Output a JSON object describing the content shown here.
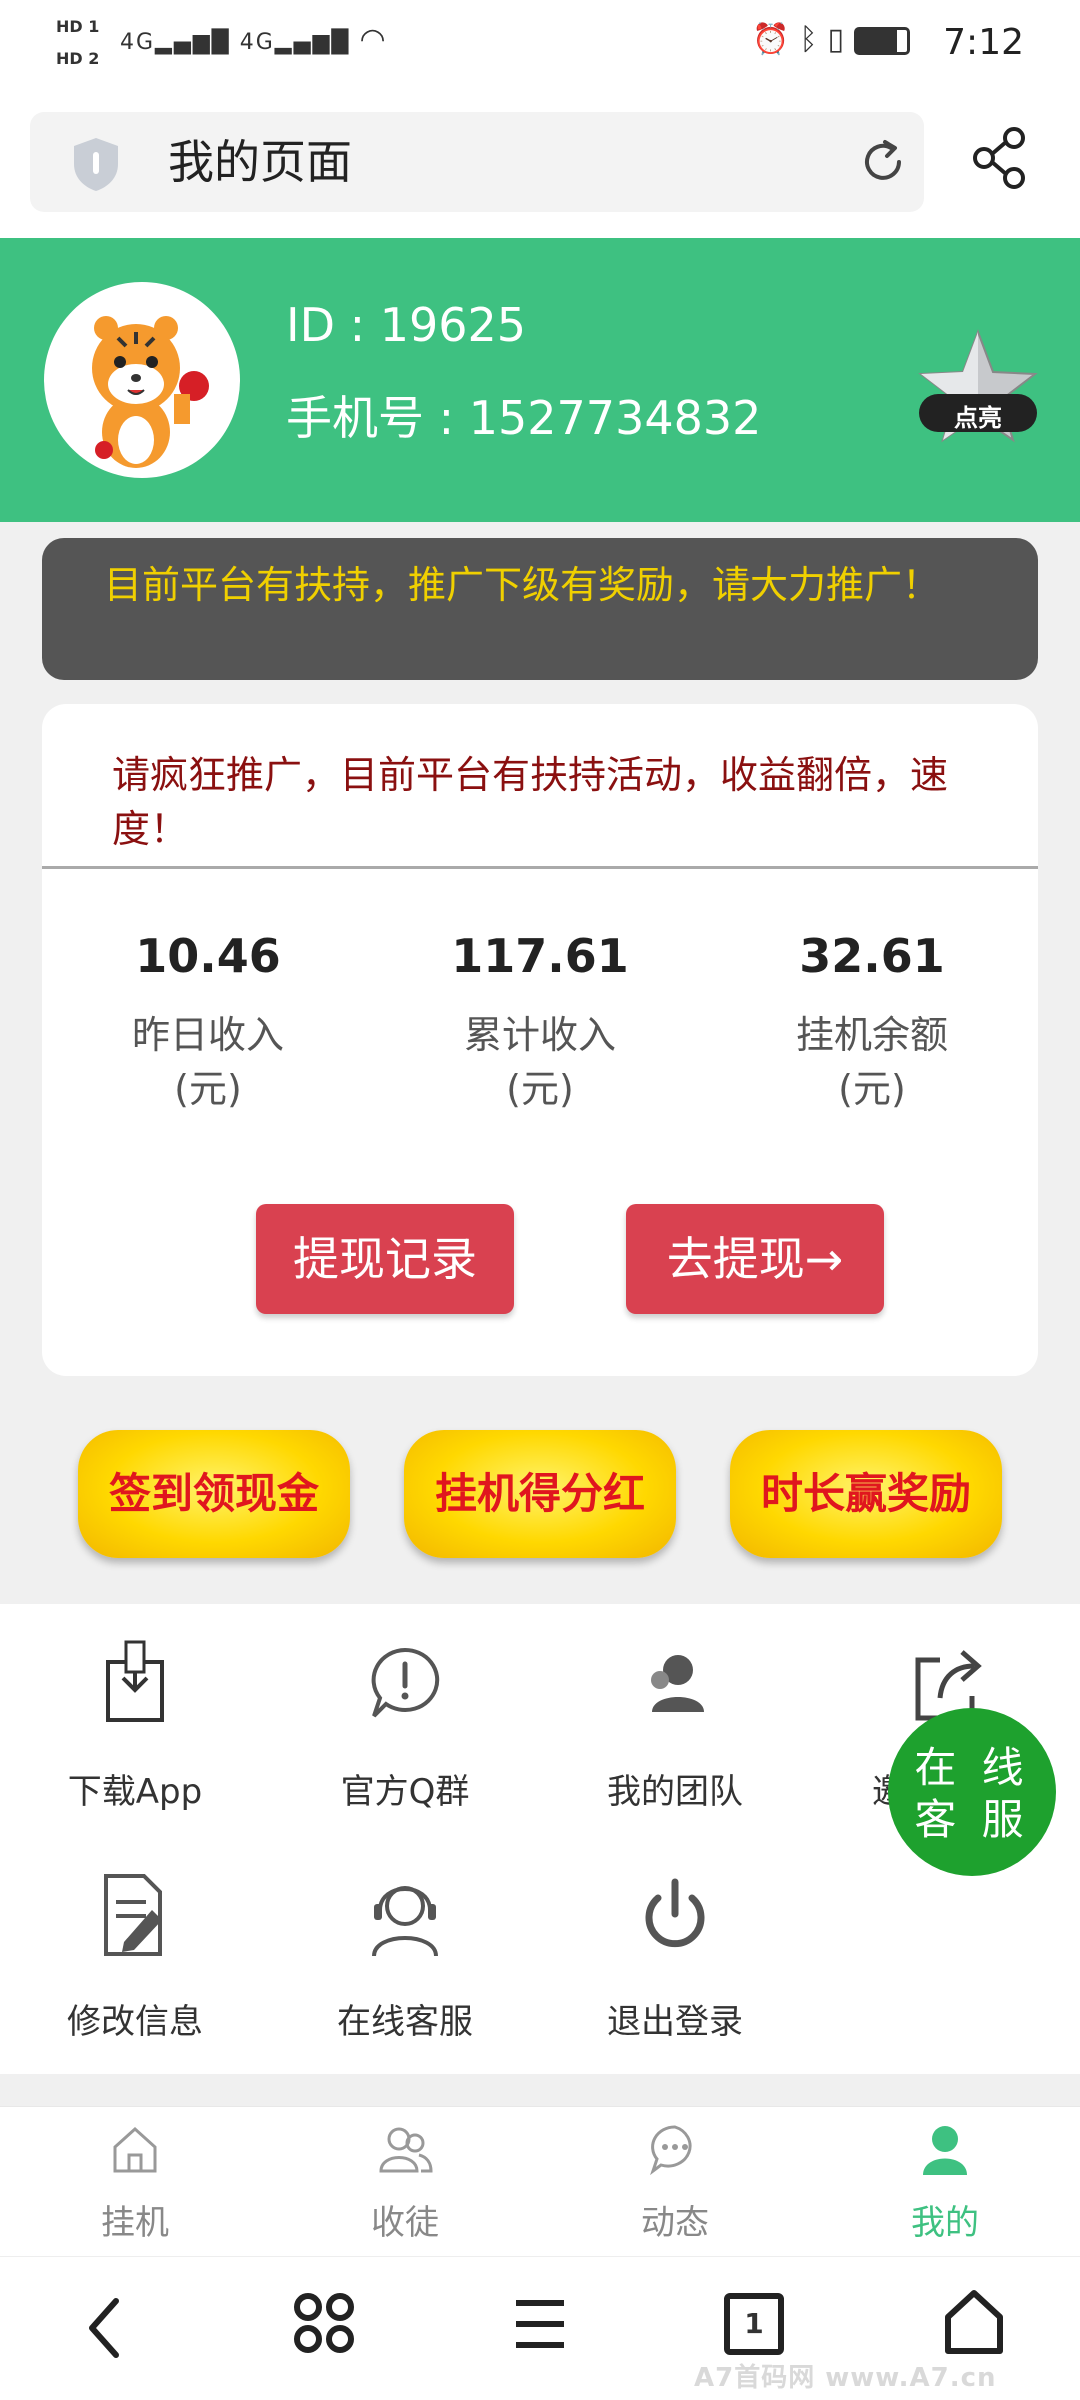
{
  "status_bar": {
    "sim1": "HD 1",
    "sim2": "HD 2",
    "signal1": "4G",
    "signal2": "4G",
    "time": "7:12"
  },
  "browser": {
    "title": "我的页面"
  },
  "profile": {
    "id_text": "ID : 19625",
    "phone_text": "手机号 : 1527734832",
    "badge_label": "点亮"
  },
  "notice": {
    "text": "目前平台有扶持，推广下级有奖励，请大力推广！"
  },
  "card": {
    "promo_text": "请疯狂推广，目前平台有扶持活动，收益翻倍，速度！",
    "stats": [
      {
        "value": "10.46",
        "label": "昨日收入",
        "unit": "(元)"
      },
      {
        "value": "117.61",
        "label": "累计收入",
        "unit": "(元)"
      },
      {
        "value": "32.61",
        "label": "挂机余额",
        "unit": "(元)"
      }
    ],
    "withdraw_record_label": "提现记录",
    "withdraw_label": "去提现→"
  },
  "promo_buttons": [
    {
      "label": "签到领现金"
    },
    {
      "label": "挂机得分红"
    },
    {
      "label": "时长赢奖励"
    }
  ],
  "grid": {
    "items": [
      {
        "label": "下载App",
        "icon": "download-icon"
      },
      {
        "label": "官方Q群",
        "icon": "exclamation-bubble-icon"
      },
      {
        "label": "我的团队",
        "icon": "team-icon"
      },
      {
        "label": "邀",
        "icon": "share-out-icon"
      },
      {
        "label": "修改信息",
        "icon": "edit-document-icon"
      },
      {
        "label": "在线客服",
        "icon": "headset-icon"
      },
      {
        "label": "退出登录",
        "icon": "power-icon"
      }
    ]
  },
  "floating": {
    "line1": "在 线",
    "line2": "客 服"
  },
  "tabs": [
    {
      "label": "挂机",
      "icon": "home-icon"
    },
    {
      "label": "收徒",
      "icon": "users-icon"
    },
    {
      "label": "动态",
      "icon": "chat-icon"
    },
    {
      "label": "我的",
      "icon": "profile-icon",
      "active": true
    }
  ],
  "nav": {
    "tab_count": "1",
    "watermark": "A7首码网 www.A7.cn"
  },
  "colors": {
    "accent_green": "#3ec181",
    "button_red": "#d94150",
    "notice_bg": "#555555",
    "notice_text": "#f0d000",
    "cs_green": "#1ea12e"
  }
}
